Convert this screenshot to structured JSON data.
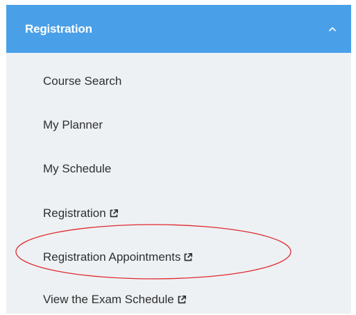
{
  "accordion": {
    "header_label": "Registration",
    "chevron_icon": "chevron-up-icon",
    "header_color": "#4aa0e8",
    "panel_color": "#edf1f4"
  },
  "menu": {
    "items": [
      {
        "label": "Course Search",
        "external": false
      },
      {
        "label": "My Planner",
        "external": false
      },
      {
        "label": "My Schedule",
        "external": false
      },
      {
        "label": "Registration",
        "external": true
      },
      {
        "label": "Registration Appointments",
        "external": true
      },
      {
        "label": "View the Exam Schedule",
        "external": true
      }
    ],
    "external_icon": "external-link-icon"
  },
  "annotation": {
    "shape": "ellipse",
    "color": "#e0282c",
    "target_item": "Registration Appointments"
  }
}
